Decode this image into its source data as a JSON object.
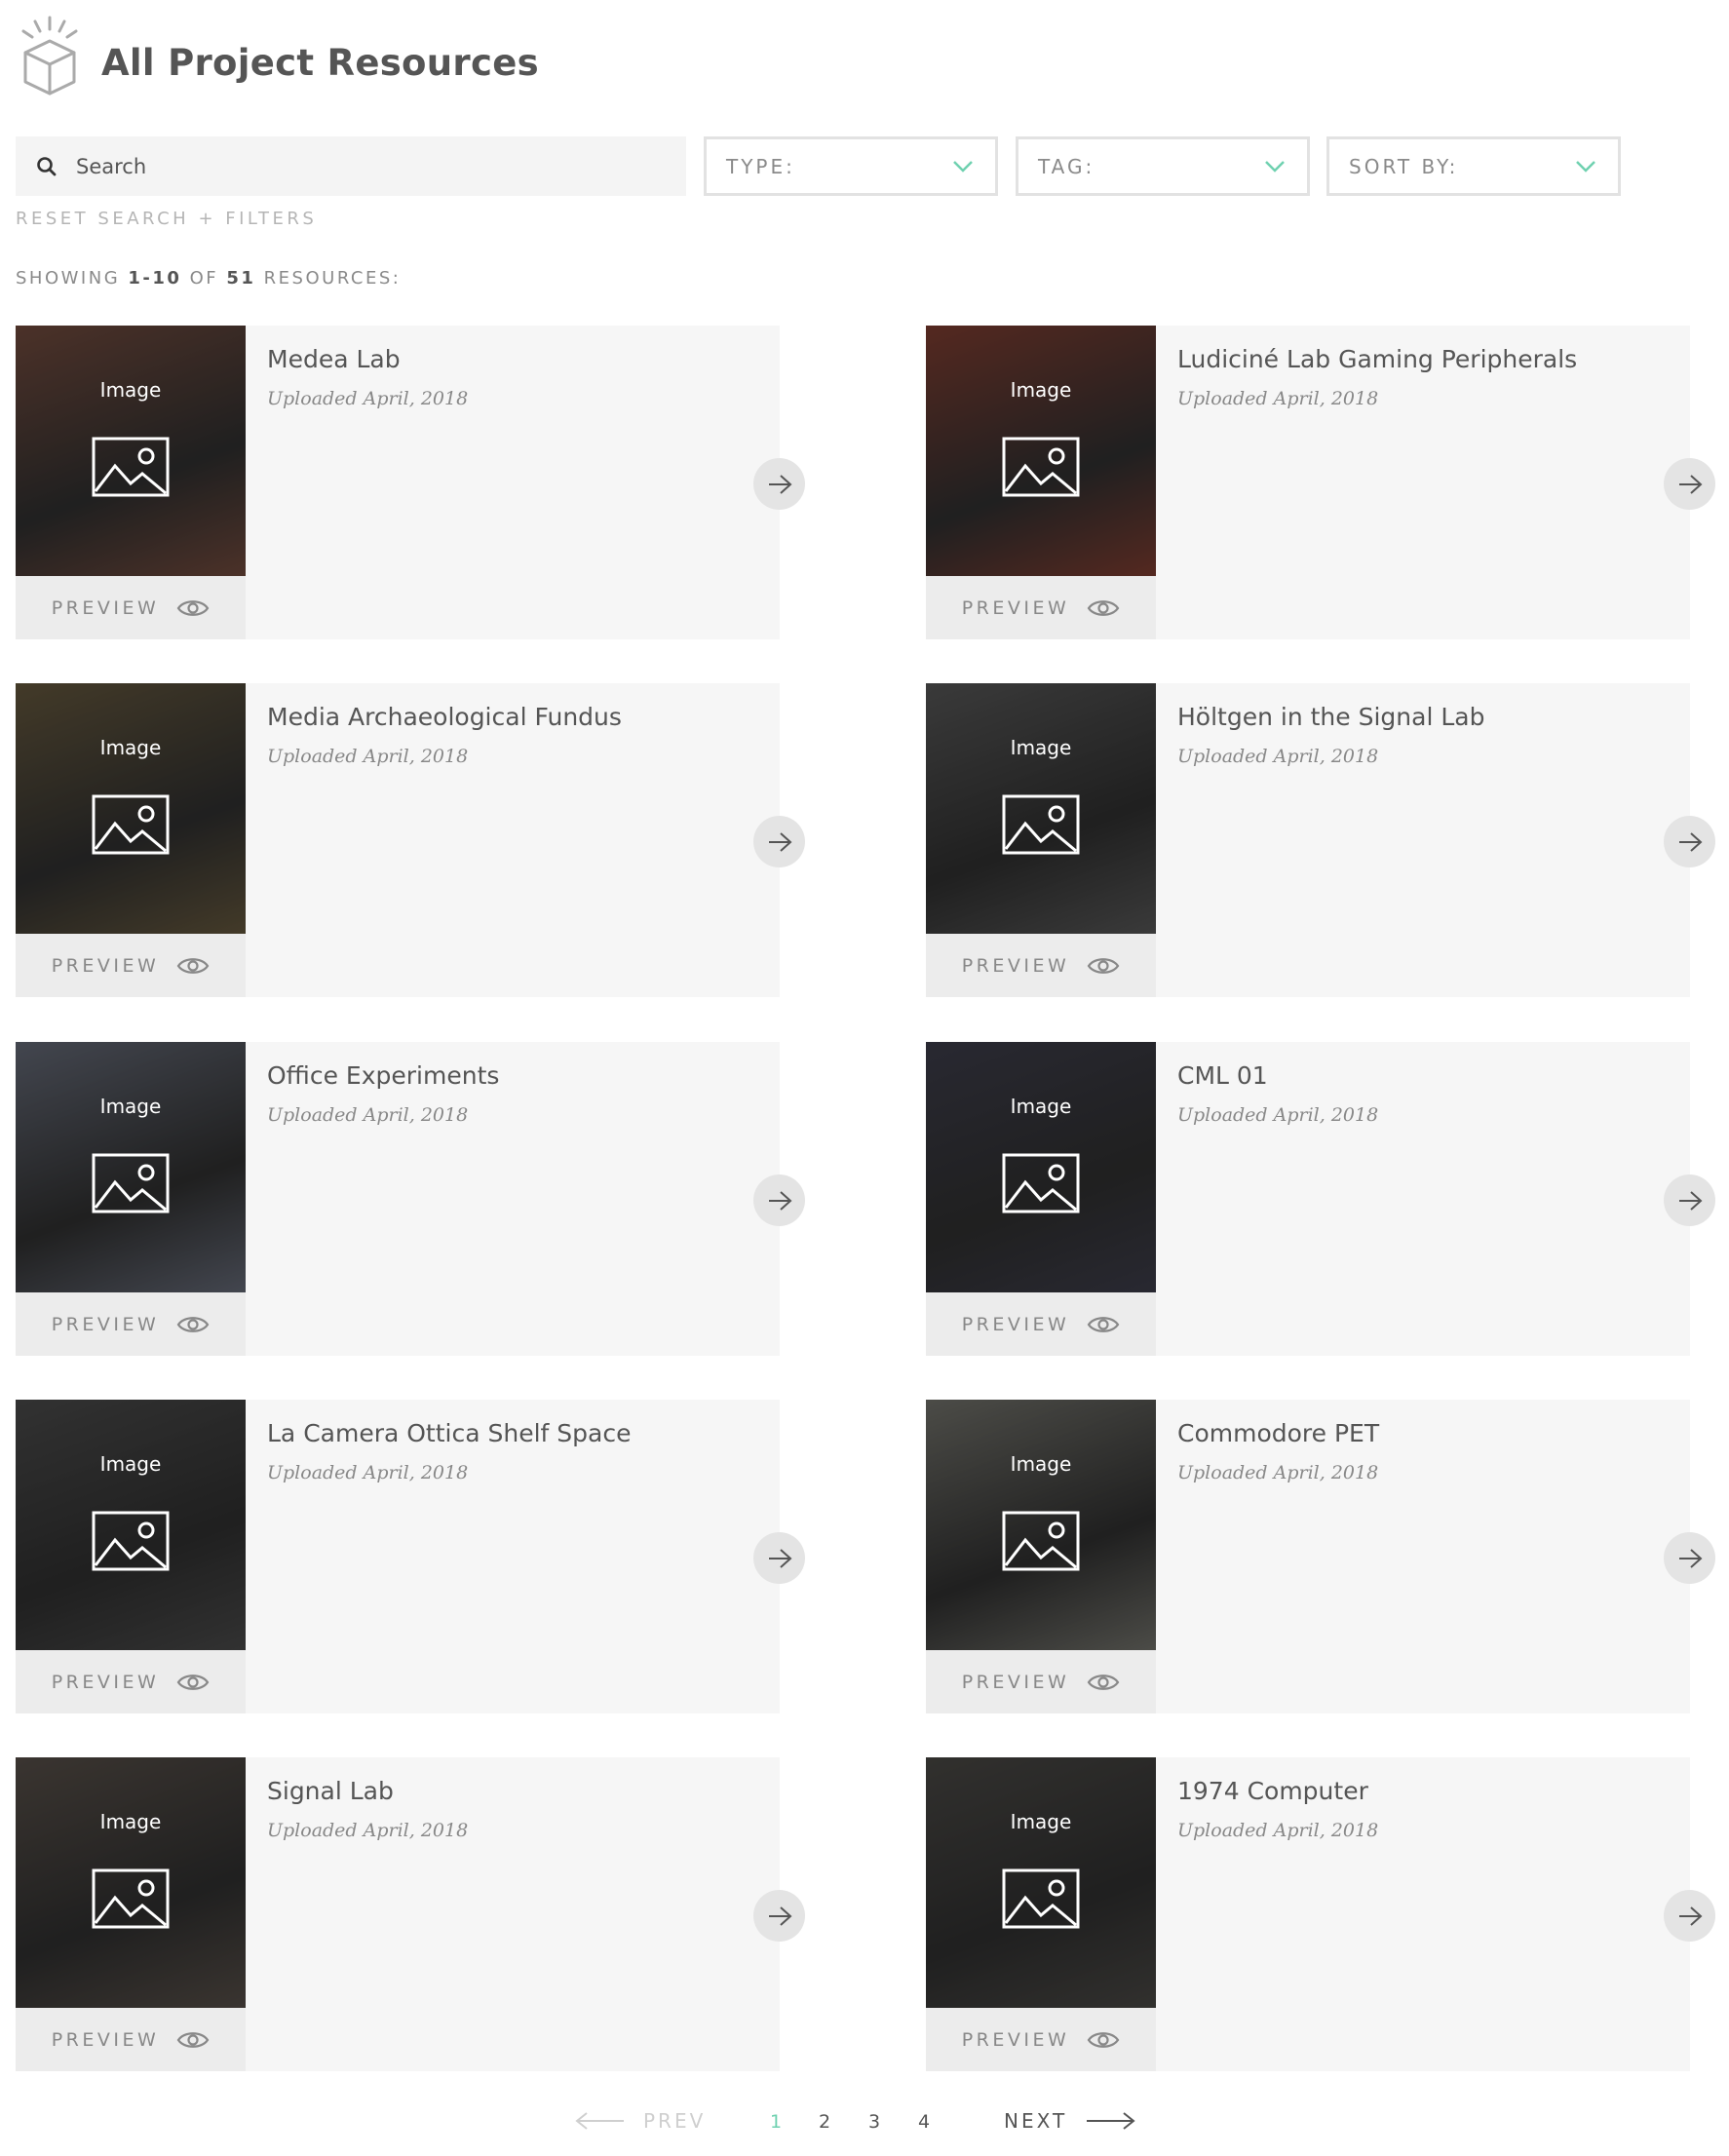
{
  "header": {
    "title": "All Project Resources",
    "logo_icon": "box-with-rays-icon"
  },
  "search": {
    "placeholder": "Search",
    "icon": "search-icon"
  },
  "filters": {
    "type_label": "TYPE:",
    "tag_label": "TAG:",
    "sort_label": "SORT BY:",
    "chevron_color": "#6fd1b0"
  },
  "reset_label": "RESET SEARCH + FILTERS",
  "showing": {
    "prefix": "SHOWING ",
    "range": "1-10",
    "of": " OF ",
    "total": "51",
    "suffix": " RESOURCES:"
  },
  "card_common": {
    "image_label": "Image",
    "preview_label": "PREVIEW"
  },
  "resources": [
    {
      "title": "Medea Lab",
      "date": "Uploaded April, 2018",
      "tint": "#7a4a3a"
    },
    {
      "title": "Ludiciné Lab Gaming Peripherals",
      "date": "Uploaded April, 2018",
      "tint": "#8a3a2a"
    },
    {
      "title": "Media Archaeological Fundus",
      "date": "Uploaded April, 2018",
      "tint": "#6a5a3a"
    },
    {
      "title": "Höltgen in the Signal Lab",
      "date": "Uploaded April, 2018",
      "tint": "#5a5a5a"
    },
    {
      "title": "Office Experiments",
      "date": "Uploaded April, 2018",
      "tint": "#6a7080"
    },
    {
      "title": "CML 01",
      "date": "Uploaded April, 2018",
      "tint": "#3a3a4a"
    },
    {
      "title": "La Camera Ottica Shelf Space",
      "date": "Uploaded April, 2018",
      "tint": "#4a4a4a"
    },
    {
      "title": "Commodore PET",
      "date": "Uploaded April, 2018",
      "tint": "#7a7a72"
    },
    {
      "title": "Signal Lab",
      "date": "Uploaded April, 2018",
      "tint": "#5a5048"
    },
    {
      "title": "1974 Computer",
      "date": "Uploaded April, 2018",
      "tint": "#4a4844"
    }
  ],
  "pagination": {
    "prev": "PREV",
    "next": "NEXT",
    "pages": [
      "1",
      "2",
      "3",
      "4"
    ],
    "active_page": "1"
  }
}
